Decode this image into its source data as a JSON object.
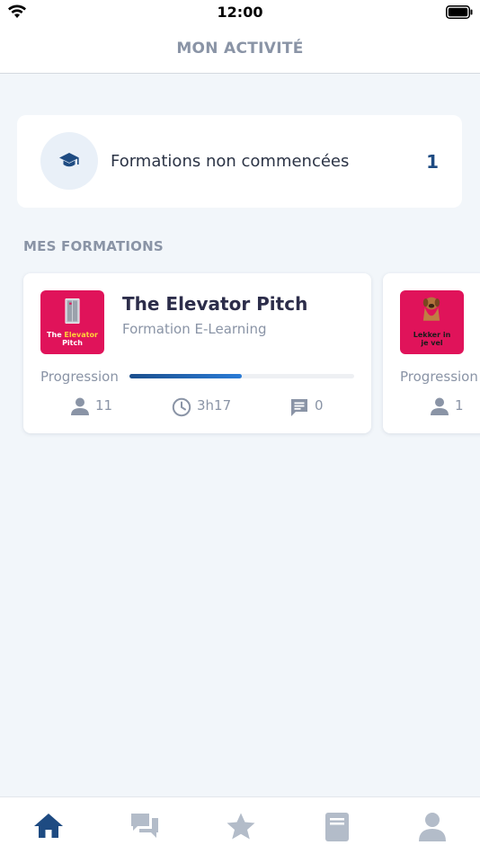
{
  "status_bar": {
    "time": "12:00"
  },
  "header": {
    "title": "MON ACTIVITÉ"
  },
  "summary": {
    "label": "Formations non commencées",
    "count": "1",
    "icon": "graduation-cap-icon"
  },
  "section": {
    "title": "MES FORMATIONS"
  },
  "courses": [
    {
      "title": "The Elevator Pitch",
      "subtitle": "Formation E-Learning",
      "thumb_caption_pre": "The ",
      "thumb_caption_accent": "Elevator",
      "thumb_caption_post": "Pitch",
      "progress_label": "Progression",
      "progress": 0.5,
      "learners": "11",
      "duration": "3h17",
      "comments": "0"
    },
    {
      "thumb_caption_line1": "Lekker in",
      "thumb_caption_line2": "je vel",
      "progress_label": "Progression",
      "learners": "1"
    }
  ],
  "tabs": [
    {
      "name": "home",
      "icon": "home-icon",
      "active": true
    },
    {
      "name": "messages",
      "icon": "chat-icon",
      "active": false
    },
    {
      "name": "favorites",
      "icon": "star-icon",
      "active": false
    },
    {
      "name": "catalog",
      "icon": "book-icon",
      "active": false
    },
    {
      "name": "profile",
      "icon": "user-icon",
      "active": false
    }
  ],
  "colors": {
    "accent": "#1e4b82",
    "muted": "#8a94a6",
    "thumb": "#e0135a",
    "inactive_tab": "#b3bcc9"
  }
}
